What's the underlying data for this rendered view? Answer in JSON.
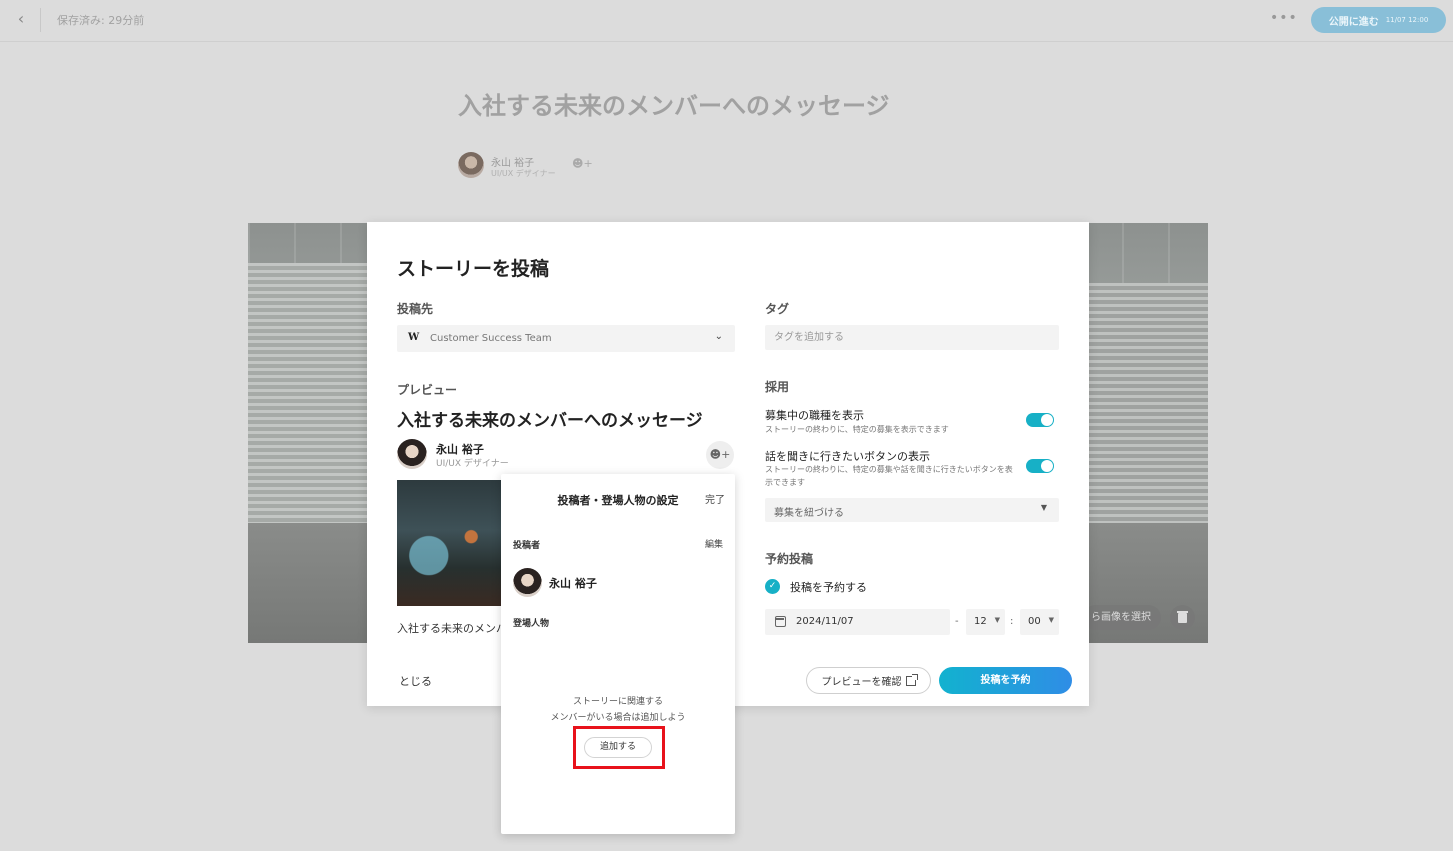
{
  "topbar": {
    "saved_status": "保存済み: 29分前",
    "more_label": "•••",
    "publish_label": "公開に進む",
    "publish_date": "11/07 12:00"
  },
  "article": {
    "title": "入社する未来のメンバーへのメッセージ",
    "author_name": "永山 裕子",
    "author_role": "UI/UX デザイナー",
    "cover_select_label": "ら画像を選択"
  },
  "modal": {
    "title": "ストーリーを投稿",
    "post_target": {
      "label": "投稿先",
      "team_logo": "W",
      "team_name": "Customer Success Team"
    },
    "tags": {
      "label": "タグ",
      "placeholder": "タグを追加する"
    },
    "preview": {
      "label": "プレビュー",
      "title": "入社する未来のメンバーへのメッセージ",
      "author_name": "永山 裕子",
      "author_role": "UI/UX デザイナー",
      "excerpt": "入社する未来のメンバーへのメッセージ"
    },
    "recruit": {
      "label": "採用",
      "toggle1_title": "募集中の職種を表示",
      "toggle1_desc": "ストーリーの終わりに、特定の募集を表示できます",
      "toggle1_on": true,
      "toggle2_title": "話を聞きに行きたいボタンの表示",
      "toggle2_desc": "ストーリーの終わりに、特定の募集や話を聞きに行きたいボタンを表示できます",
      "toggle2_on": true,
      "select_placeholder": "募集を紐づける"
    },
    "schedule": {
      "label": "予約投稿",
      "checkbox_label": "投稿を予約する",
      "checked": true,
      "date": "2024/11/07",
      "hour": "12",
      "minute": "00",
      "dash": "-",
      "colon": ":"
    },
    "footer": {
      "close_label": "とじる",
      "preview_button": "プレビューを確認",
      "submit_button": "投稿を予約"
    }
  },
  "popover": {
    "title": "投稿者・登場人物の設定",
    "done_label": "完了",
    "author_label": "投稿者",
    "edit_label": "編集",
    "author_name": "永山 裕子",
    "characters_label": "登場人物",
    "empty_line1": "ストーリーに関連する",
    "empty_line2": "メンバーがいる場合は追加しよう",
    "add_button": "追加する"
  },
  "colors": {
    "accent": "#17b0c6",
    "highlight": "#e8121b"
  }
}
